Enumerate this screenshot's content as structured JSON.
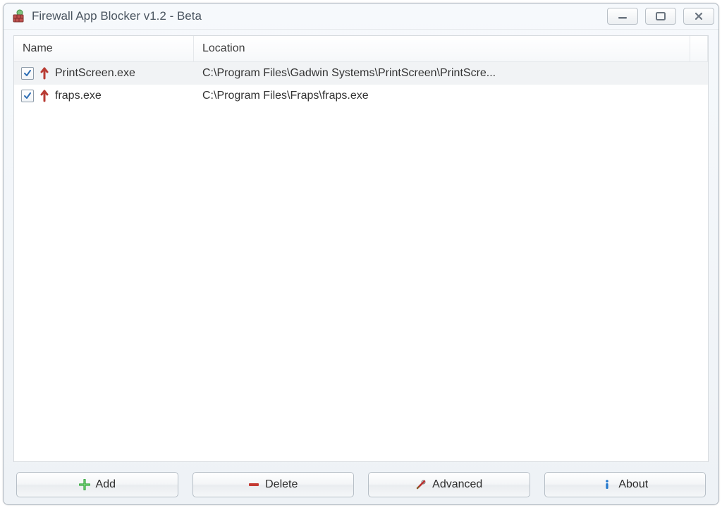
{
  "window": {
    "title": "Firewall App Blocker v1.2 - Beta"
  },
  "columns": {
    "name": "Name",
    "location": "Location"
  },
  "rows": [
    {
      "checked": true,
      "name": "PrintScreen.exe",
      "location": "C:\\Program Files\\Gadwin Systems\\PrintScreen\\PrintScre...",
      "selected": true
    },
    {
      "checked": true,
      "name": "fraps.exe",
      "location": "C:\\Program Files\\Fraps\\fraps.exe",
      "selected": false
    }
  ],
  "buttons": {
    "add": "Add",
    "delete": "Delete",
    "advanced": "Advanced",
    "about": "About"
  }
}
